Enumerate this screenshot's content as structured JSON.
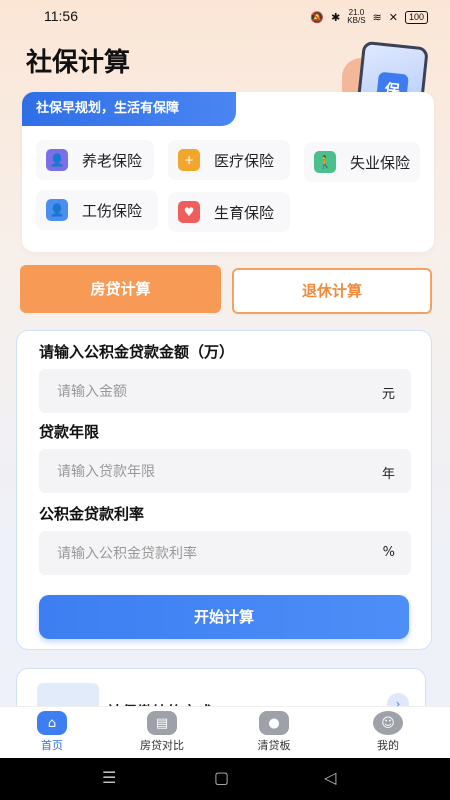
{
  "status": {
    "time": "11:56",
    "net_speed": "21.0",
    "net_unit": "KB/S",
    "battery": "100"
  },
  "page_title": "社保计算",
  "insurance": {
    "banner": "社保早规划，生活有保障",
    "items": [
      {
        "label": "养老保险",
        "icon": "elder-icon",
        "color": "#7b6fe6"
      },
      {
        "label": "医疗保险",
        "icon": "medical-kit-icon",
        "color": "#f0a72c"
      },
      {
        "label": "失业保险",
        "icon": "walking-person-icon",
        "color": "#4cc08a"
      },
      {
        "label": "工伤保险",
        "icon": "injured-person-icon",
        "color": "#4a8ef0"
      },
      {
        "label": "生育保险",
        "icon": "birth-icon",
        "color": "#ef5d5d"
      }
    ]
  },
  "tabs": {
    "left": "房贷计算",
    "right": "退休计算"
  },
  "form": {
    "amount_label": "请输入公积金贷款金额（万）",
    "amount_placeholder": "请输入金额",
    "amount_unit": "元",
    "years_label": "贷款年限",
    "years_placeholder": "请输入贷款年限",
    "years_unit": "年",
    "rate_label": "公积金贷款利率",
    "rate_placeholder": "请输入公积金贷款利率",
    "rate_unit": "%",
    "submit": "开始计算"
  },
  "article": {
    "title": "社保缴纳的方式"
  },
  "tabbar": [
    {
      "label": "首页",
      "icon": "home-icon",
      "active": true
    },
    {
      "label": "房贷对比",
      "icon": "compare-icon",
      "active": false
    },
    {
      "label": "清贷板",
      "icon": "money-bag-icon",
      "active": false
    },
    {
      "label": "我的",
      "icon": "profile-icon",
      "active": false
    }
  ],
  "colors": {
    "primary": "#3d7ef2",
    "accent": "#f79a56"
  }
}
